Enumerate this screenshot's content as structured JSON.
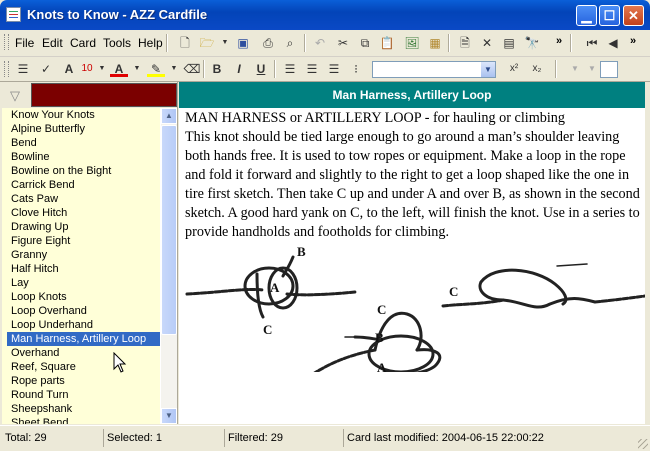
{
  "window": {
    "title": "Knots to Know - AZZ Cardfile"
  },
  "menu": [
    "File",
    "Edit",
    "Card",
    "Tools",
    "Help"
  ],
  "toolbar": {
    "font_size": "10",
    "bold": "B",
    "italic": "I",
    "underline": "U",
    "superscript": "x²",
    "subscript": "x₂",
    "overflow": "»"
  },
  "sidebar": {
    "filter_value": "",
    "items": [
      "Know Your Knots",
      "Alpine Butterfly",
      "Bend",
      "Bowline",
      "Bowline on the Bight",
      "Carrick Bend",
      "Cats Paw",
      "Clove Hitch",
      "Drawing Up",
      "Figure Eight",
      "Granny",
      "Half Hitch",
      "Lay",
      "Loop Knots",
      "Loop Overhand",
      "Loop Underhand",
      "Man Harness, Artillery Loop",
      "Overhand",
      "Reef, Square",
      "Rope parts",
      "Round Turn",
      "Sheepshank",
      "Sheet Bend"
    ],
    "selected_index": 16
  },
  "card": {
    "header": "Man Harness, Artillery Loop",
    "title": "MAN HARNESS or ARTILLERY LOOP - for hauling or climbing",
    "body": "This knot should be tied large enough to go around a man’s shoulder leaving both hands free. It is used to tow ropes or equipment. Make a loop in the rope and fold it forward and slightly to the right to get a loop shaped like the one in tire first sketch. Then take C up and under A and over B, as shown in the second sketch. A good hard yank on C, to the left, will finish the knot. Use in a series to provide handholds and footholds for climbing.",
    "sketch_labels": {
      "a1": "A",
      "b1": "B",
      "c1": "C",
      "a2": "A",
      "b2": "B",
      "c2": "C",
      "c3": "C"
    }
  },
  "status": {
    "total": "Total: 29",
    "selected": "Selected: 1",
    "filtered": "Filtered: 29",
    "modified": "Card last modified: 2004-06-15  22:00:22"
  },
  "colors": {
    "titlebar": "#0a49c6",
    "header_teal": "#008080",
    "filter_bg": "#7b0000",
    "list_bg": "#ffffd8",
    "selection": "#316ac5"
  }
}
